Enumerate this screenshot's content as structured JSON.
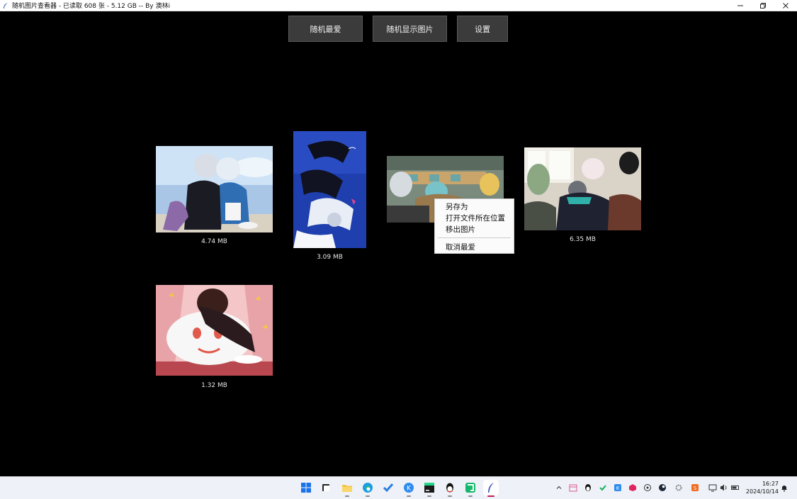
{
  "window": {
    "title": "随机图片查看器 - 已读取 608 张 - 5.12 GB -- By 澳林i",
    "controls": {
      "minimize": "─",
      "restore": "❐",
      "close": "✕"
    }
  },
  "toolbar": {
    "random_favorite": "随机最爱",
    "random_show": "随机显示图片",
    "settings": "设置"
  },
  "gallery": {
    "images": [
      {
        "size": "4.74 MB"
      },
      {
        "size": "3.09 MB"
      },
      {
        "size": ""
      },
      {
        "size": "6.35 MB"
      },
      {
        "size": "1.32 MB"
      }
    ]
  },
  "context_menu": {
    "items": [
      "另存为",
      "打开文件所在位置",
      "移出图片",
      "取消最爱"
    ]
  },
  "taskbar": {
    "clock": {
      "time": "16:27",
      "date": "2024/10/14"
    },
    "tray": {
      "chevron": "^"
    }
  },
  "colors": {
    "background": "#000000",
    "button_bg": "#3b3b3b",
    "taskbar_bg": "#eef1f7",
    "context_menu_bg": "#fbfbfb"
  }
}
